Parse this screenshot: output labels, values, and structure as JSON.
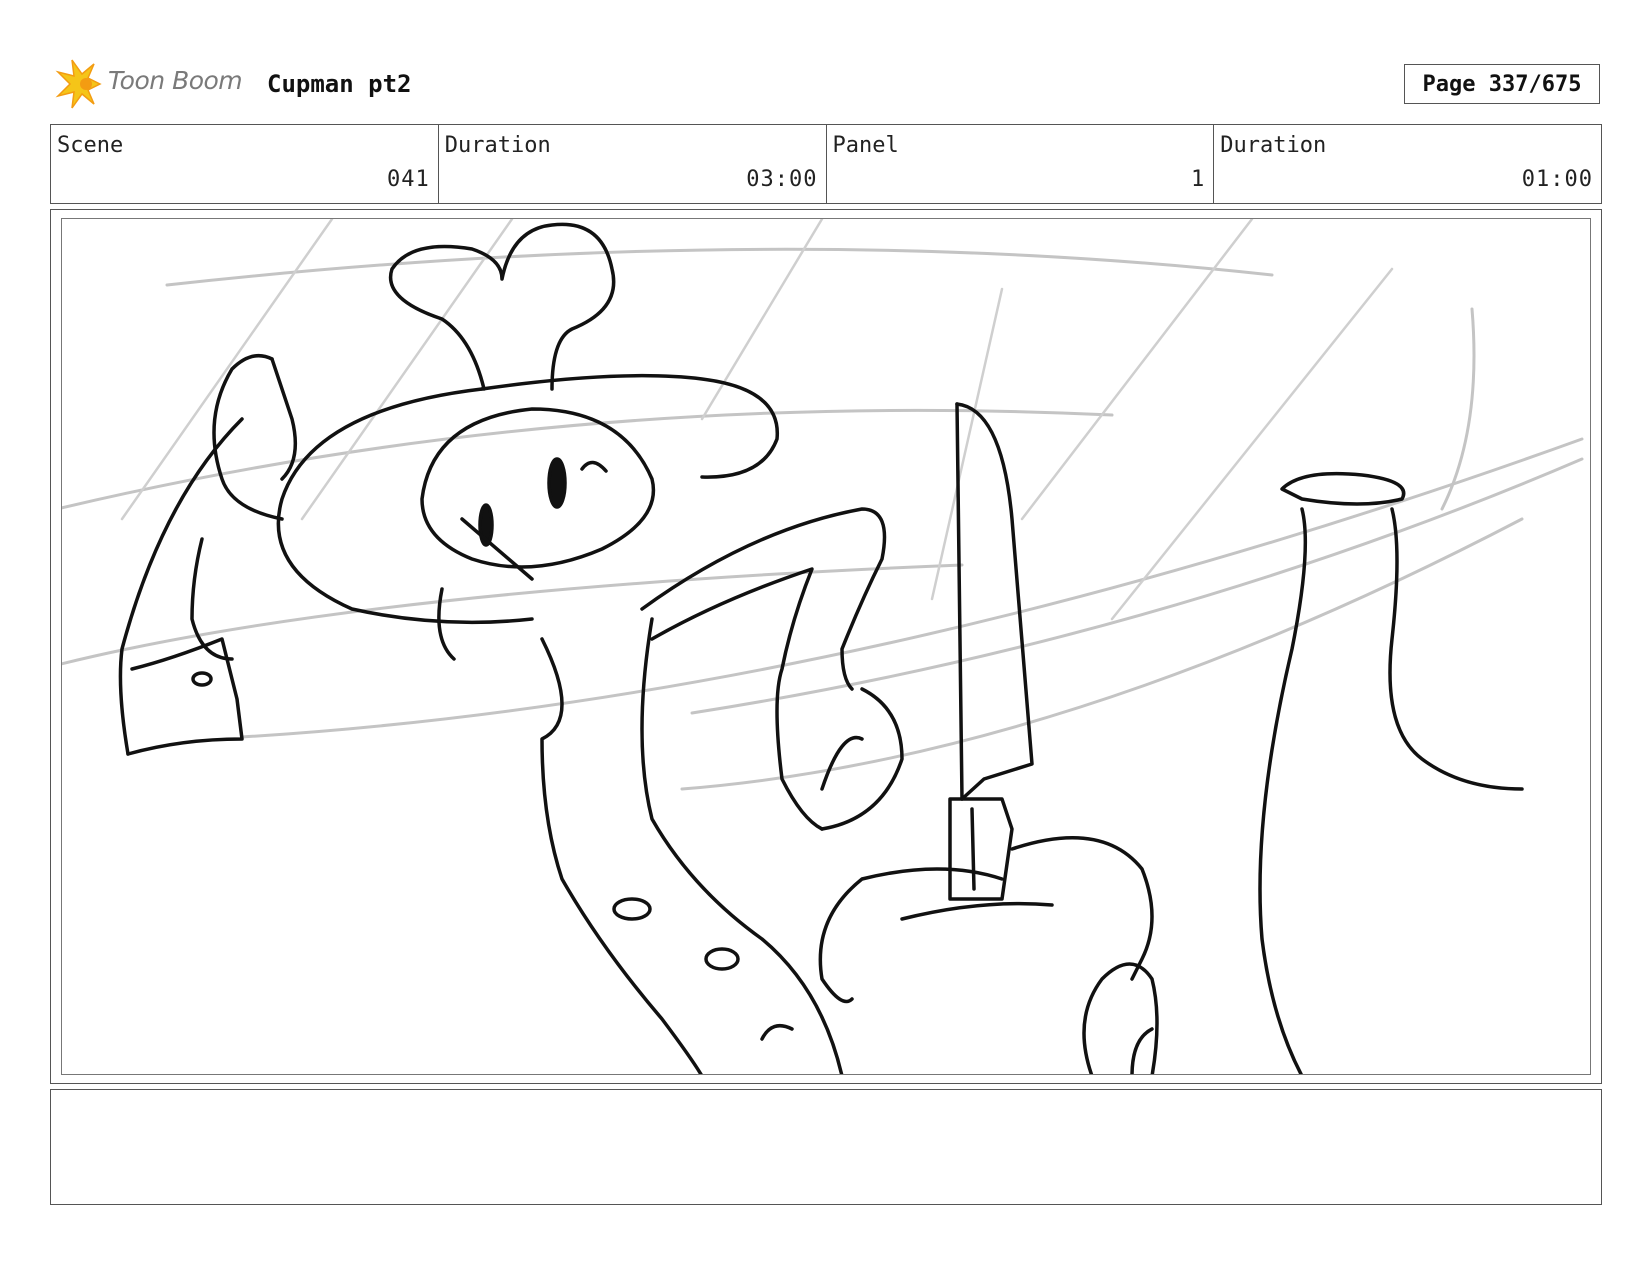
{
  "header": {
    "brand": "Toon Boom",
    "project_title": "Cupman pt2",
    "page_label": "Page 337/675"
  },
  "info": {
    "scene_label": "Scene",
    "scene_value": "041",
    "duration_label": "Duration",
    "duration_value": "03:00",
    "panel_label": "Panel",
    "panel_value": "1",
    "panel_duration_label": "Duration",
    "panel_duration_value": "01:00"
  },
  "panel": {
    "image_icons": [
      "chef-character-sketch",
      "knife-sketch",
      "vase-sketch",
      "motion-lines-sketch"
    ]
  },
  "notes": {
    "text": ""
  },
  "colors": {
    "logo_yellow": "#f5c518",
    "logo_orange": "#f39c12",
    "sketch_line": "#111111",
    "motion_line": "#c4c4c4"
  }
}
